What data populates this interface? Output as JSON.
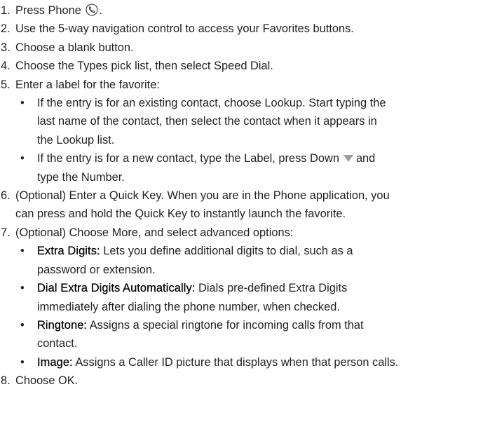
{
  "steps": [
    {
      "num": "1.",
      "pre": "Press Phone",
      "post": "."
    },
    {
      "num": "2.",
      "text": "Use the 5-way navigation control to access your Favorites buttons."
    },
    {
      "num": "3.",
      "text": "Choose a blank button."
    },
    {
      "num": "4.",
      "text": "Choose the Types pick list, then select Speed Dial."
    },
    {
      "num": "5.",
      "text": "Enter a label for the favorite:",
      "bullets": [
        {
          "l1": "If the entry is for an existing contact, choose Lookup. Start typing the",
          "l2": "last name of the contact, then select the contact when it appears in",
          "l3": "the Lookup list."
        },
        {
          "l1a": "If the entry is for a new contact, type the Label, press Down",
          "l1b": "and",
          "l2": "type the Number."
        }
      ]
    },
    {
      "num": "6.",
      "l1": "(Optional) Enter a Quick Key. When you are in the Phone application, you",
      "l2": "can press and hold the Quick Key to instantly launch the favorite."
    },
    {
      "num": "7.",
      "text": "(Optional) Choose More, and select advanced options:",
      "bullets": [
        {
          "term": "Extra Digits:",
          "l1": " Lets you define additional digits to dial, such as a",
          "l2": "password or extension."
        },
        {
          "term": "Dial Extra Digits Automatically:",
          "l1": " Dials pre-defined Extra Digits",
          "l2": "immediately after dialing the phone number, when checked."
        },
        {
          "term": "Ringtone:",
          "l1": " Assigns a special ringtone for incoming calls from that",
          "l2": "contact."
        },
        {
          "term": "Image:",
          "l1": " Assigns a Caller ID picture that displays when that person calls."
        }
      ]
    },
    {
      "num": "8.",
      "text": "Choose OK."
    }
  ],
  "bullet_char": "•",
  "icons": {
    "phone": "phone-key-icon",
    "down": "down-arrow-icon",
    "color": "#9d9c9c"
  }
}
